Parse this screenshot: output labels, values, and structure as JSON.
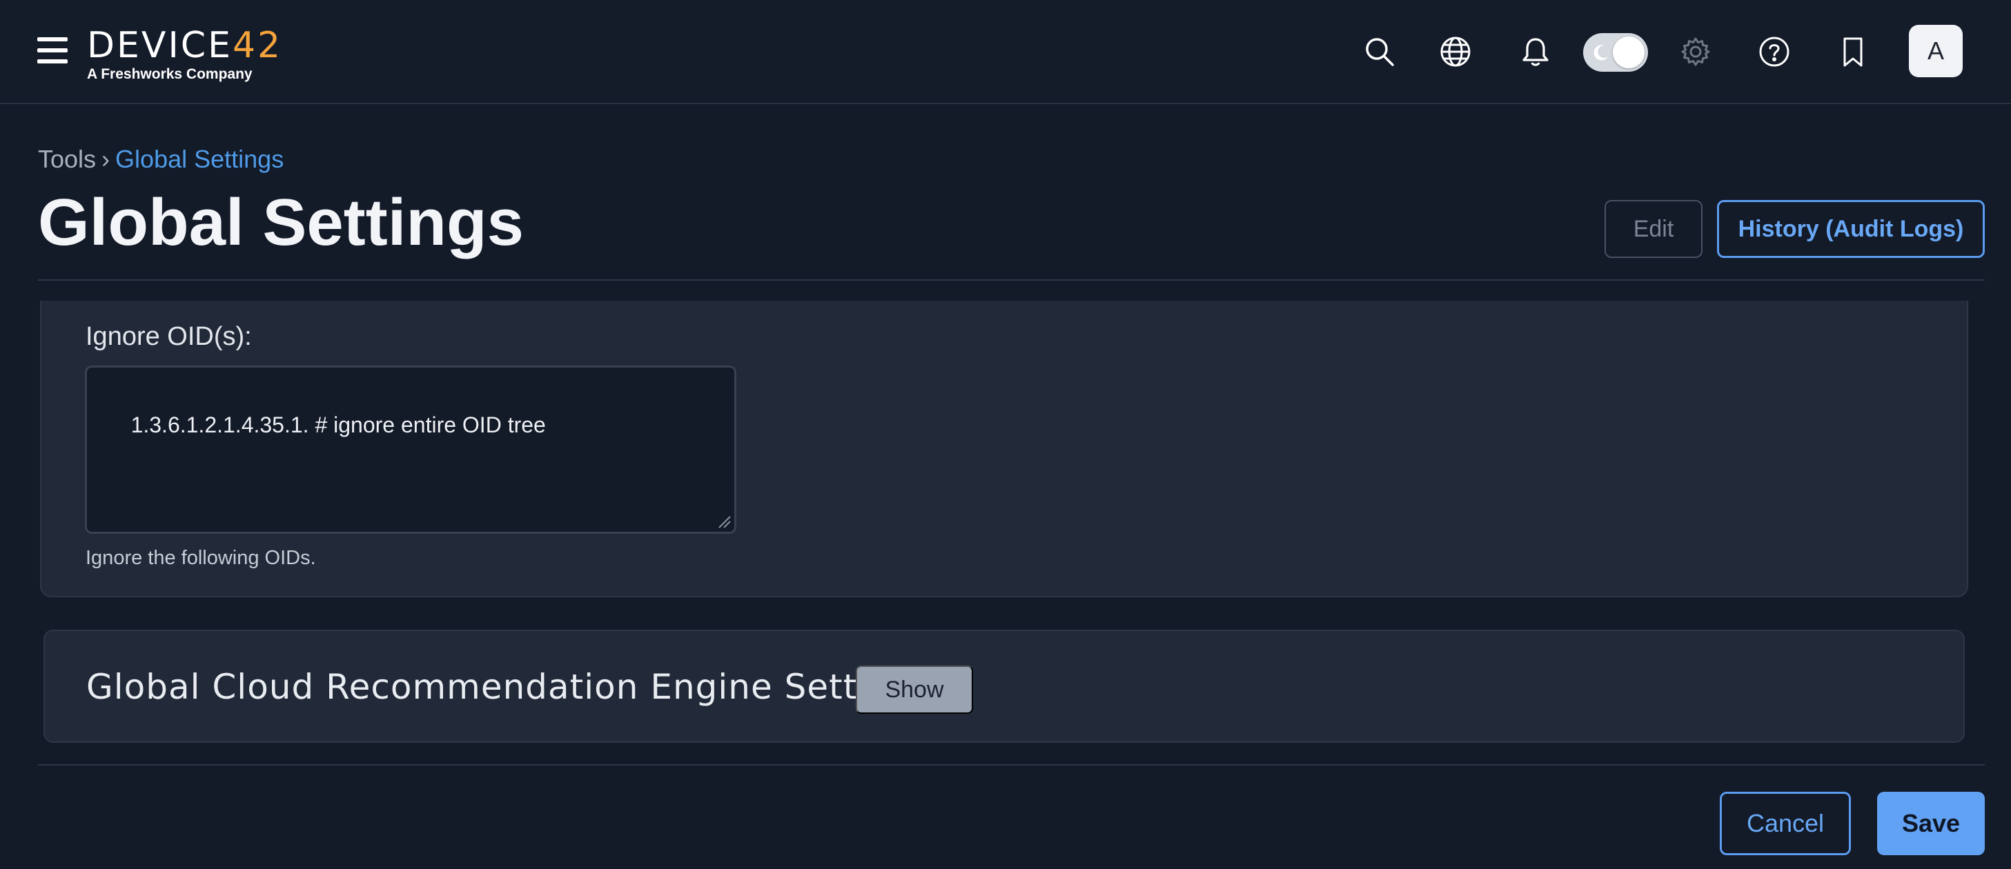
{
  "header": {
    "logo_main_prefix": "DEVICE",
    "logo_main_accent": "42",
    "logo_sub": "A Freshworks Company",
    "avatar_initial": "A",
    "icons": [
      "menu-icon",
      "search-icon",
      "globe-icon",
      "bell-icon",
      "theme-toggle",
      "gear-icon",
      "help-icon",
      "bookmark-icon"
    ]
  },
  "breadcrumb": {
    "root": "Tools",
    "separator": "›",
    "current": "Global Settings"
  },
  "page": {
    "title": "Global Settings",
    "edit_label": "Edit",
    "history_label": "History (Audit Logs)"
  },
  "oid": {
    "label": "Ignore OID(s):",
    "value": "1.3.6.1.2.1.4.35.1. # ignore entire OID tree",
    "help": "Ignore the following OIDs."
  },
  "cloud": {
    "title": "Global Cloud Recommendation Engine Settings",
    "show_label": "Show"
  },
  "footer": {
    "cancel_label": "Cancel",
    "save_label": "Save"
  },
  "colors": {
    "background": "#131a28",
    "panel": "#222a39",
    "accent_blue": "#62a2f4",
    "logo_accent": "#f5a33b"
  }
}
